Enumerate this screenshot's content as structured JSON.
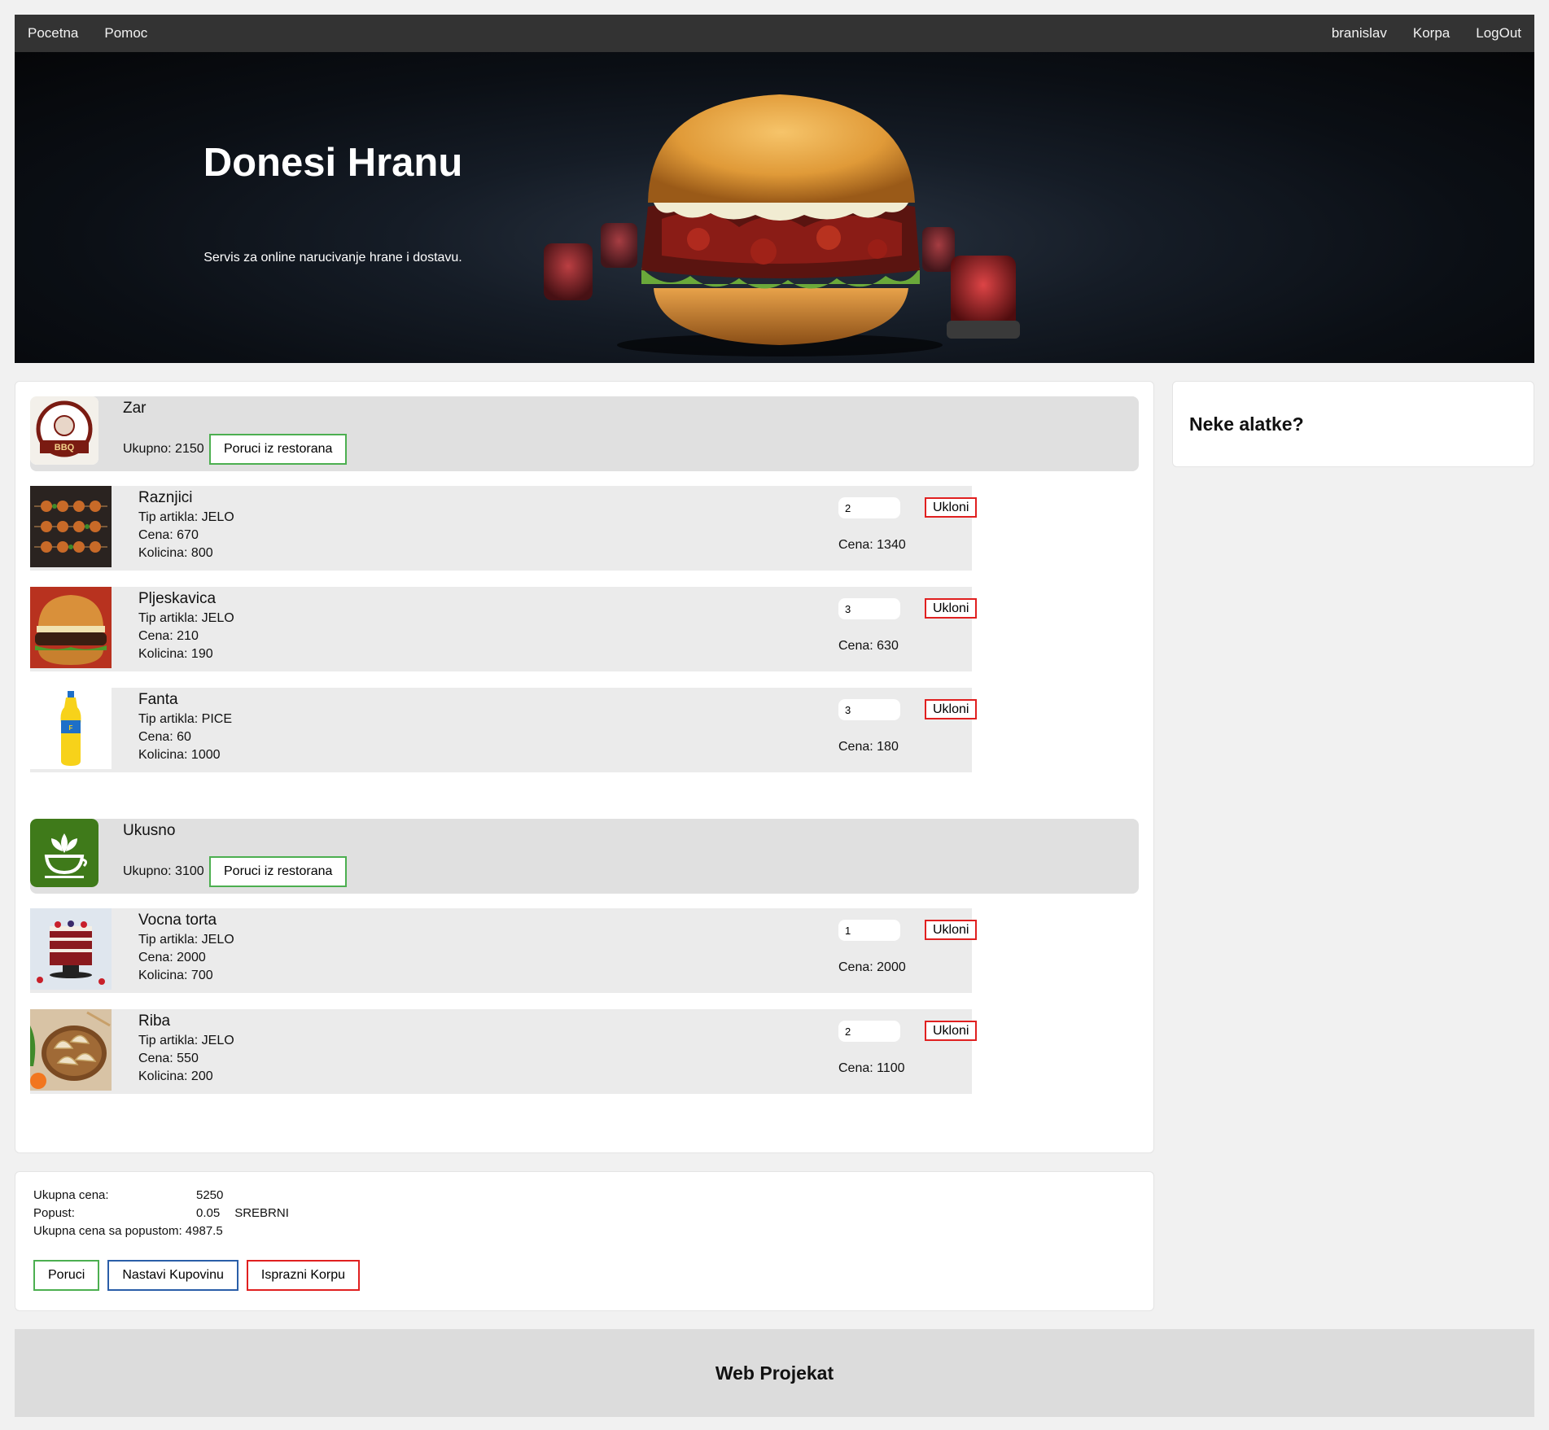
{
  "nav": {
    "left": [
      "Pocetna",
      "Pomoc"
    ],
    "right": [
      "branislav",
      "Korpa",
      "LogOut"
    ]
  },
  "hero": {
    "title": "Donesi Hranu",
    "subtitle": "Servis za online narucivanje hrane i dostavu."
  },
  "labels": {
    "tip": "Tip artikla: ",
    "cena": "Cena: ",
    "kolicina": "Kolicina: ",
    "ukupno": "Ukupno: ",
    "order_rest": "Poruci iz restorana",
    "remove": "Ukloni"
  },
  "restaurants": [
    {
      "name": "Zar",
      "total": "2150",
      "logo_icon": "bbq-logo-icon",
      "items": [
        {
          "name": "Raznjici",
          "type": "JELO",
          "price": "670",
          "amount": "800",
          "qty": "2",
          "line_price": "1340",
          "icon": "skewers-photo"
        },
        {
          "name": "Pljeskavica",
          "type": "JELO",
          "price": "210",
          "amount": "190",
          "qty": "3",
          "line_price": "630",
          "icon": "burger-photo"
        },
        {
          "name": "Fanta",
          "type": "PICE",
          "price": "60",
          "amount": "1000",
          "qty": "3",
          "line_price": "180",
          "icon": "fanta-bottle-photo"
        }
      ]
    },
    {
      "name": "Ukusno",
      "total": "3100",
      "logo_icon": "green-cup-logo-icon",
      "items": [
        {
          "name": "Vocna torta",
          "type": "JELO",
          "price": "2000",
          "amount": "700",
          "qty": "1",
          "line_price": "2000",
          "icon": "cake-photo"
        },
        {
          "name": "Riba",
          "type": "JELO",
          "price": "550",
          "amount": "200",
          "qty": "2",
          "line_price": "1100",
          "icon": "dumplings-photo"
        }
      ]
    }
  ],
  "tools": {
    "title": "Neke alatke?"
  },
  "summary": {
    "total_label": "Ukupna cena:",
    "total_value": "5250",
    "discount_label": "Popust:",
    "discount_value": "0.05",
    "tier": "SREBRNI",
    "discounted_label": "Ukupna cena sa popustom:",
    "discounted_value": "4987.5",
    "btn_order": "Poruci",
    "btn_continue": "Nastavi Kupovinu",
    "btn_empty": "Isprazni Korpu"
  },
  "footer": {
    "title": "Web Projekat"
  },
  "colors": {
    "nav": "#333333",
    "green": "#4CAF50",
    "red": "#e02020",
    "blue": "#2a5ea8"
  }
}
